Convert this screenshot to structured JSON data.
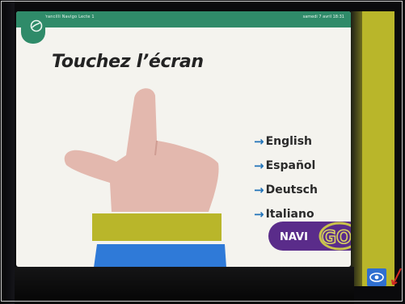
{
  "header": {
    "left_text": "Francilli Navigo Lecte 1",
    "right_text": "samedi 7 avril 18:31"
  },
  "screen": {
    "title": "Touchez l’écran"
  },
  "languages": [
    {
      "label": "English"
    },
    {
      "label": "Español"
    },
    {
      "label": "Deutsch"
    },
    {
      "label": "Italiano"
    }
  ],
  "logo": {
    "text": "NAVI",
    "accent_text": "GO"
  },
  "colors": {
    "header": "#2f8b69",
    "arrow": "#1f72b8",
    "skin": "#e3b8ae",
    "cuff_yellow": "#b9b62a",
    "sleeve_blue": "#2f7ad8",
    "logo_purple": "#5a2c8a"
  },
  "icons": {
    "arrow": "→"
  }
}
